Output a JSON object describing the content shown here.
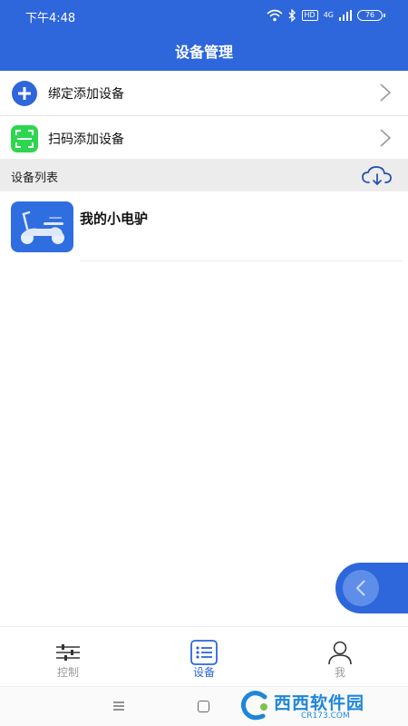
{
  "status_bar": {
    "time": "下午4:48",
    "hd": "HD",
    "network": "4G",
    "battery": "76"
  },
  "header": {
    "title": "设备管理"
  },
  "actions": [
    {
      "label": "绑定添加设备",
      "icon": "plus-circle-icon",
      "color": "#2e66db"
    },
    {
      "label": "扫码添加设备",
      "icon": "scan-icon",
      "color": "#2dd64f"
    }
  ],
  "device_section": {
    "title": "设备列表",
    "icon": "cloud-download-icon"
  },
  "devices": [
    {
      "name": "我的小电驴",
      "icon": "scooter-icon"
    }
  ],
  "tabs": [
    {
      "label": "控制",
      "icon": "sliders-icon",
      "active": false
    },
    {
      "label": "设备",
      "icon": "list-icon",
      "active": true
    },
    {
      "label": "我",
      "icon": "person-icon",
      "active": false
    }
  ],
  "watermark": {
    "brand": "西西软件园",
    "sub": "CR173.COM"
  },
  "colors": {
    "primary": "#2e66db",
    "scan_green": "#2dd64f",
    "section_bg": "#ececec"
  }
}
